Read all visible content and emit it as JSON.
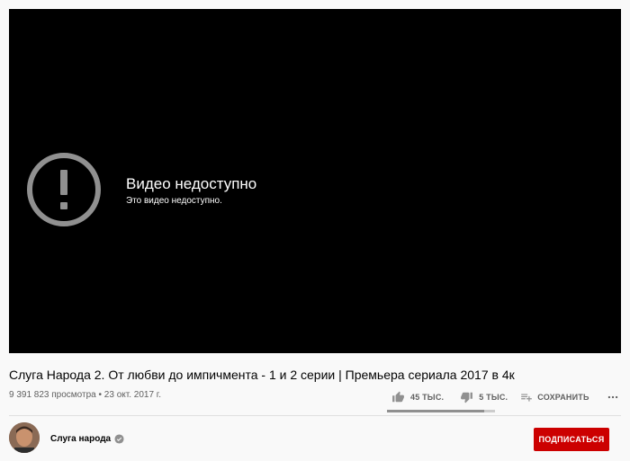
{
  "player": {
    "error_title": "Видео недоступно",
    "error_subtitle": "Это видео недоступно.",
    "error_icon": "alert-circle-icon"
  },
  "video": {
    "title": "Слуга Народа 2. От любви до импичмента - 1 и 2 серии | Премьера сериала 2017 в 4к",
    "views": "9 391 823 просмотра",
    "separator": " • ",
    "date": "23 окт. 2017 г."
  },
  "actions": {
    "like_count": "45 ТЫС.",
    "dislike_count": "5 ТЫС.",
    "save_label": "СОХРАНИТЬ",
    "like_ratio": 0.9
  },
  "channel": {
    "name": "Слуга народа",
    "verified": true,
    "subscribe_label": "ПОДПИСАТЬСЯ"
  },
  "colors": {
    "subscribe_bg": "#cc0000",
    "player_bg": "#000000",
    "page_bg": "#f9f9f9"
  }
}
